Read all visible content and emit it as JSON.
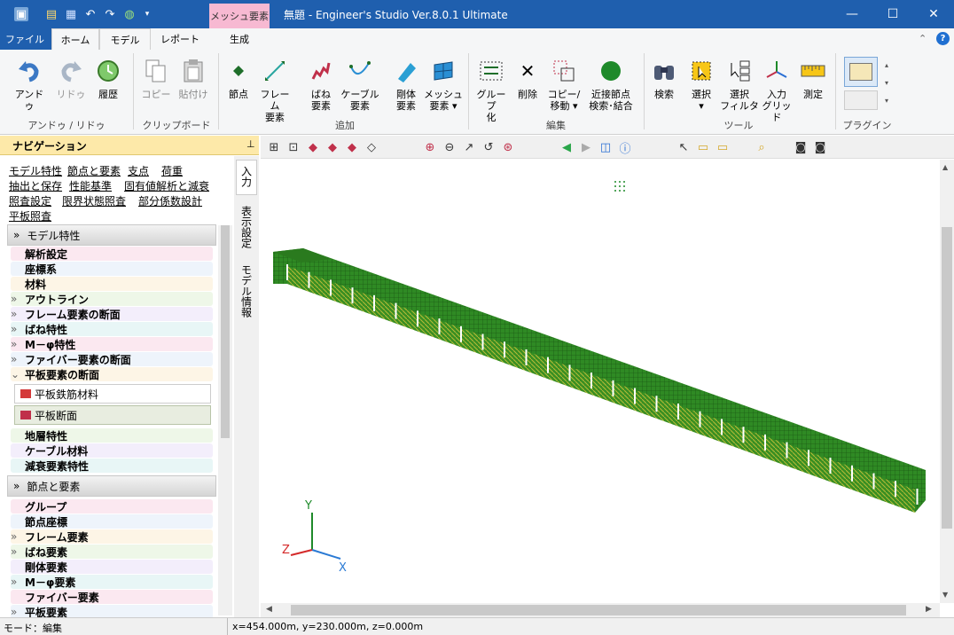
{
  "titlebar": {
    "context_tab": "メッシュ要素",
    "title": "無題 - Engineer's Studio Ver.8.0.1 Ultimate"
  },
  "tabs": [
    "ファイル",
    "ホーム",
    "モデル",
    "レポート",
    "生成"
  ],
  "ribbon": {
    "buttons": {
      "undo": "アンドゥ",
      "redo": "リドゥ",
      "history": "履歴",
      "copy": "コピー",
      "paste": "貼付け",
      "node": "節点",
      "frame": "フレーム",
      "frame2": "要素",
      "spring": "ばね",
      "spring2": "要素",
      "cable": "ケーブル",
      "cable2": "要素",
      "rigid": "剛体",
      "rigid2": "要素",
      "mesh": "メッシュ",
      "mesh2": "要素 ▾",
      "group": "グループ",
      "group2": "化",
      "delete": "削除",
      "copymove": "コピー/",
      "copymove2": "移動 ▾",
      "near": "近接節点",
      "near2": "検索･結合",
      "search": "検索",
      "select": "選択",
      "select2": "▾",
      "filter": "選択",
      "filter2": "フィルタ",
      "grid": "入力",
      "grid2": "グリッド",
      "measure": "測定"
    },
    "groups": {
      "undo": "アンドゥ / リドゥ",
      "clip": "クリップボード",
      "add": "追加",
      "edit": "編集",
      "tools": "ツール",
      "plugin": "プラグイン"
    }
  },
  "nav": {
    "title": "ナビゲーション",
    "links": [
      "モデル特性",
      "節点と要素",
      "支点",
      "荷重",
      "抽出と保存",
      "性能基準",
      "固有値解析と減衰",
      "照査設定",
      "限界状態照査",
      "部分係数設計",
      "平板照査"
    ],
    "section1": "モデル特性",
    "items1": [
      "解析設定",
      "座標系",
      "材料",
      "アウトライン",
      "フレーム要素の断面",
      "ばね特性",
      "M－φ特性",
      "ファイバー要素の断面",
      "平板要素の断面"
    ],
    "sub1": [
      "平板鉄筋材料",
      "平板断面"
    ],
    "items1b": [
      "地層特性",
      "ケーブル材料",
      "減衰要素特性"
    ],
    "section2": "節点と要素",
    "items2": [
      "グループ",
      "節点座標",
      "フレーム要素",
      "ばね要素",
      "剛体要素",
      "M－φ要素",
      "ファイバー要素",
      "平板要素"
    ],
    "vtabs": [
      "入力",
      "表示設定",
      "モデル情報"
    ]
  },
  "axes": {
    "x": "X",
    "y": "Y",
    "z": "Z"
  },
  "status": {
    "mode": "モード：編集",
    "coords": "x=454.000m, y=230.000m, z=0.000m"
  },
  "colors": {
    "title": "#1f5fae",
    "mesh": "#2d8a1e",
    "accent": "#f7b9d2"
  }
}
